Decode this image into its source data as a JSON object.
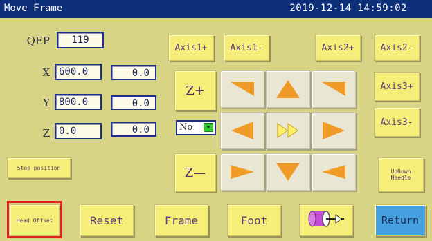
{
  "window": {
    "title": "Move Frame",
    "datetime": "2019-12-14 14:59:02"
  },
  "qep": {
    "label": "QEP",
    "value": "119"
  },
  "coords": {
    "x": {
      "label": "X",
      "value": "600.0",
      "offset": "0.0"
    },
    "y": {
      "label": "Y",
      "value": "800.0",
      "offset": "0.0"
    },
    "z": {
      "label": "Z",
      "value": "0.0",
      "offset": "0.0"
    }
  },
  "axis_buttons": {
    "axis1_plus": "Axis1+",
    "axis1_minus": "Axis1-",
    "axis2_plus": "Axis2+",
    "axis2_minus": "Axis2-",
    "axis3_plus": "Axis3+",
    "axis3_minus": "Axis3-"
  },
  "z_buttons": {
    "z_plus": "Z+",
    "z_minus": "Z—"
  },
  "speed_select": {
    "value": "No"
  },
  "left_buttons": {
    "stop_position": "Stop position"
  },
  "right_buttons": {
    "updown_needle": "UpDown\nNeedle"
  },
  "bottom_buttons": {
    "head_offset": "Head Offset",
    "reset": "Reset",
    "frame": "Frame",
    "foot": "Foot",
    "ret": "Return"
  },
  "icons": {
    "up": "arrow-up-icon",
    "down": "arrow-down-icon",
    "left": "arrow-left-icon",
    "right": "arrow-right-icon",
    "up_left": "arrow-up-left-icon",
    "up_right": "arrow-up-right-icon",
    "down_left": "arrow-down-left-icon",
    "down_right": "arrow-down-right-icon",
    "fast_forward": "fast-forward-icon",
    "thread_spool": "thread-spool-icon"
  },
  "colors": {
    "titlebar": "#0d2f7a",
    "background": "#d8d486",
    "button": "#f5ef7a",
    "return_button": "#46a0e0",
    "jog_arrow": "#f09a28",
    "highlight": "#e1211e"
  }
}
